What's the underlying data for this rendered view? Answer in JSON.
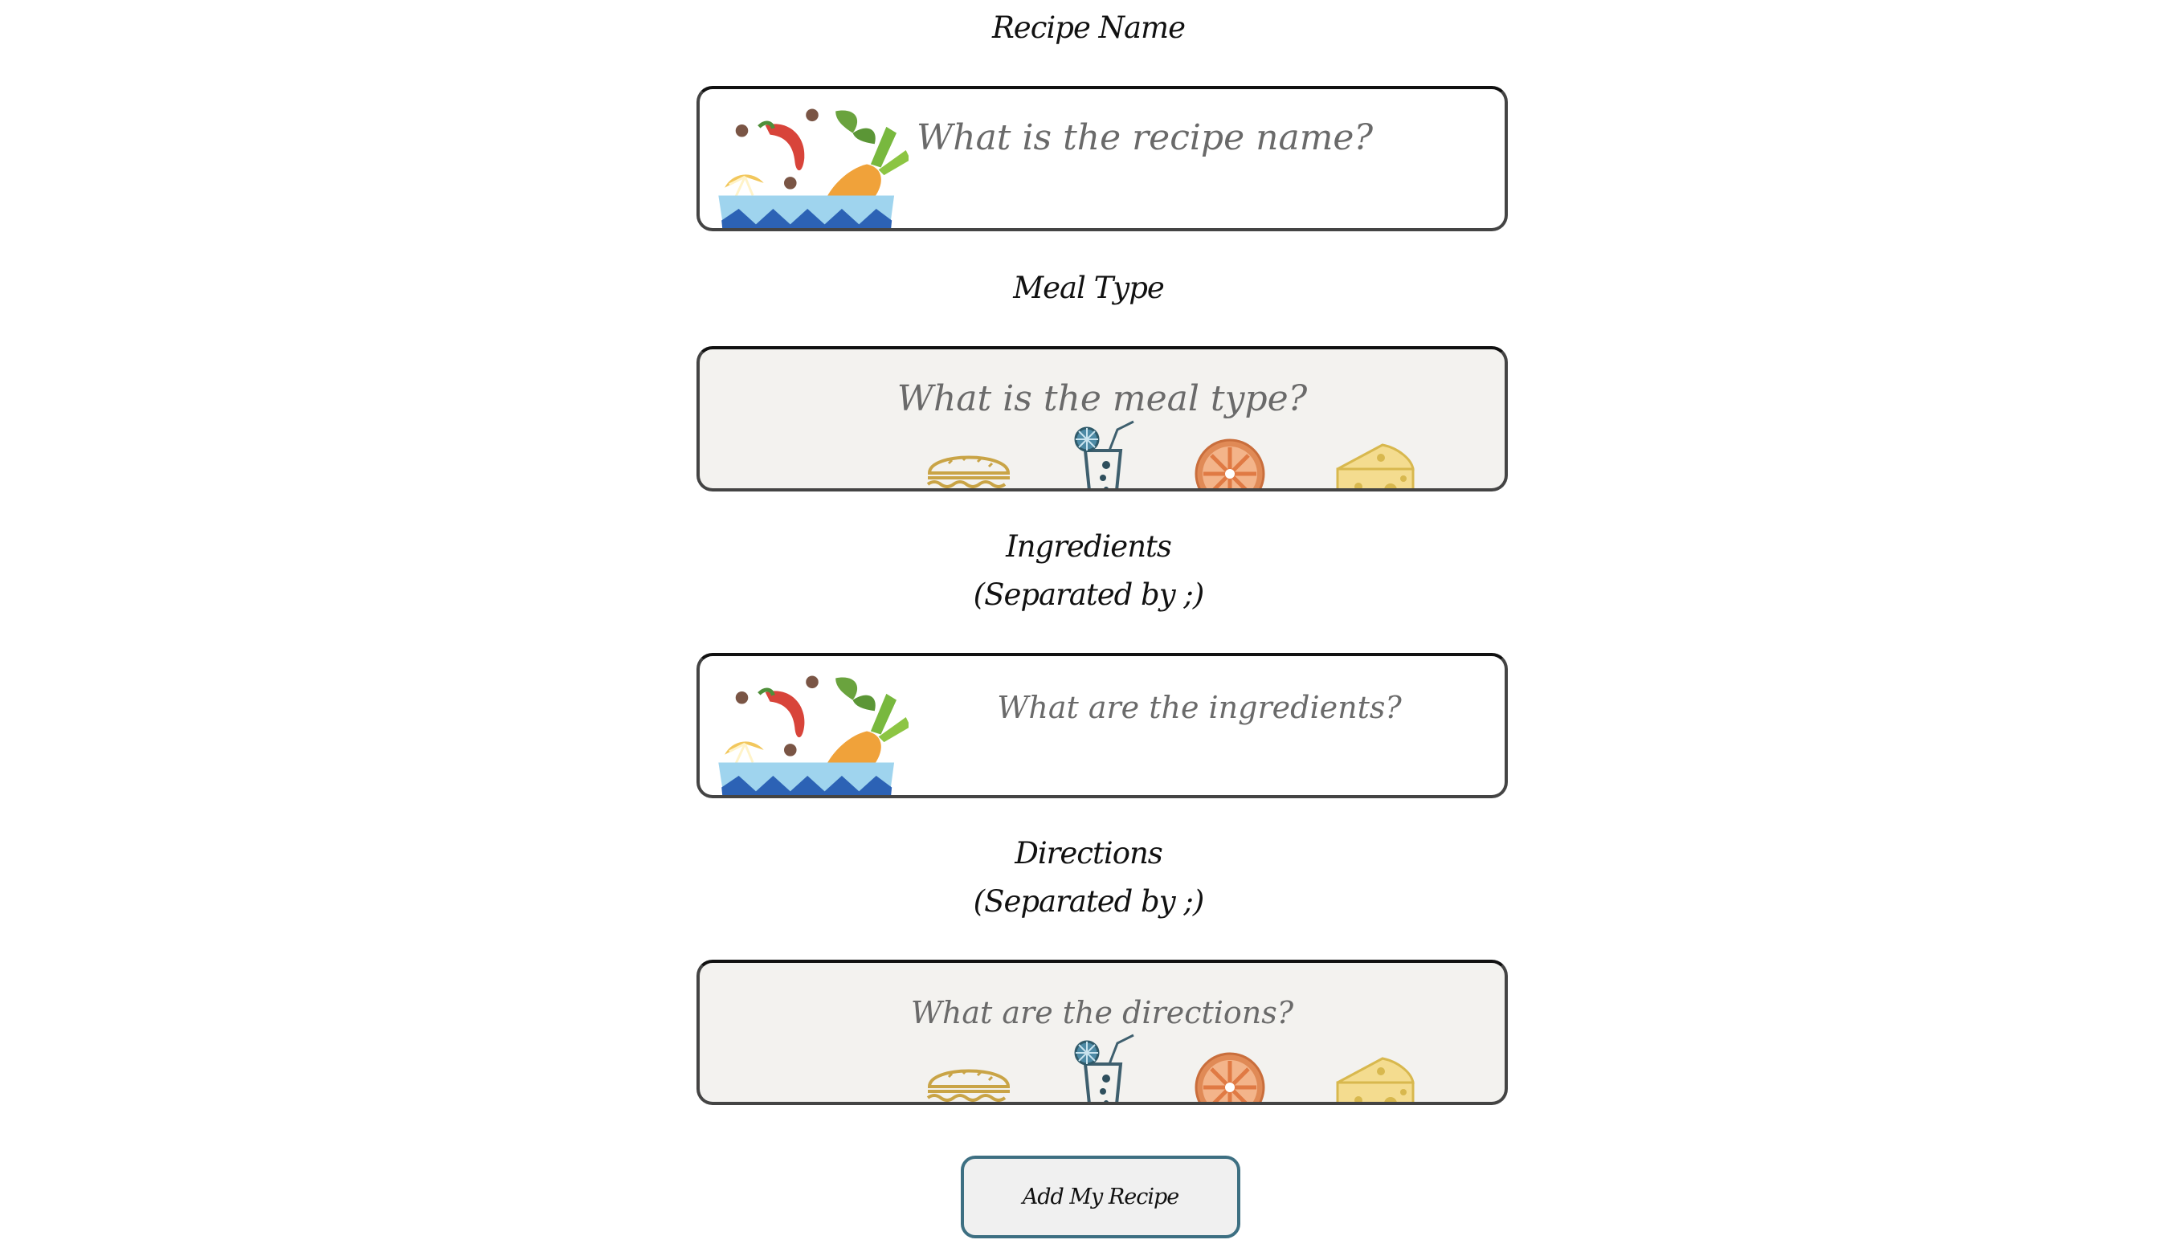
{
  "form": {
    "recipe_name": {
      "label": "Recipe Name",
      "placeholder": "What is the recipe name?",
      "value": ""
    },
    "meal_type": {
      "label": "Meal Type",
      "placeholder": "What is the meal type?",
      "value": ""
    },
    "ingredients": {
      "label_line1": "Ingredients",
      "label_line2": "(Separated by ;)",
      "placeholder": "What are the ingredients?",
      "value": ""
    },
    "directions": {
      "label_line1": "Directions",
      "label_line2": "(Separated by ;)",
      "placeholder": "What are the directions?",
      "value": ""
    },
    "submit_label": "Add My Recipe"
  },
  "icons": {
    "bowl": "vegetable-bowl-icon",
    "burger": "burger-icon",
    "drink": "drink-glass-icon",
    "orange": "orange-slice-icon",
    "cheese": "cheese-icon"
  },
  "colors": {
    "field_border": "#444444",
    "grey_field_bg": "#f3f2ef",
    "placeholder": "#6a6a6a",
    "button_border": "#3d6f82",
    "button_bg": "#f0f0f0"
  }
}
